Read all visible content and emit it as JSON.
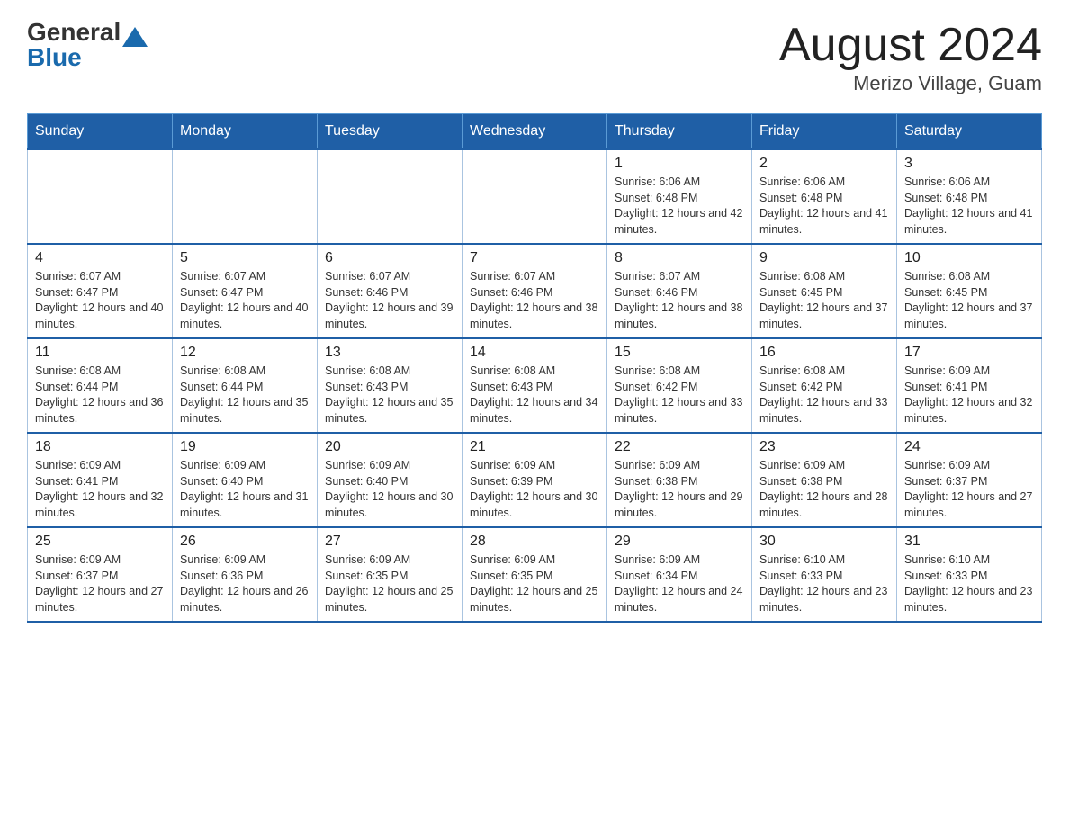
{
  "header": {
    "logo_general": "General",
    "logo_blue": "Blue",
    "title": "August 2024",
    "subtitle": "Merizo Village, Guam"
  },
  "days_of_week": [
    "Sunday",
    "Monday",
    "Tuesday",
    "Wednesday",
    "Thursday",
    "Friday",
    "Saturday"
  ],
  "weeks": [
    [
      {
        "day": "",
        "info": ""
      },
      {
        "day": "",
        "info": ""
      },
      {
        "day": "",
        "info": ""
      },
      {
        "day": "",
        "info": ""
      },
      {
        "day": "1",
        "info": "Sunrise: 6:06 AM\nSunset: 6:48 PM\nDaylight: 12 hours and 42 minutes."
      },
      {
        "day": "2",
        "info": "Sunrise: 6:06 AM\nSunset: 6:48 PM\nDaylight: 12 hours and 41 minutes."
      },
      {
        "day": "3",
        "info": "Sunrise: 6:06 AM\nSunset: 6:48 PM\nDaylight: 12 hours and 41 minutes."
      }
    ],
    [
      {
        "day": "4",
        "info": "Sunrise: 6:07 AM\nSunset: 6:47 PM\nDaylight: 12 hours and 40 minutes."
      },
      {
        "day": "5",
        "info": "Sunrise: 6:07 AM\nSunset: 6:47 PM\nDaylight: 12 hours and 40 minutes."
      },
      {
        "day": "6",
        "info": "Sunrise: 6:07 AM\nSunset: 6:46 PM\nDaylight: 12 hours and 39 minutes."
      },
      {
        "day": "7",
        "info": "Sunrise: 6:07 AM\nSunset: 6:46 PM\nDaylight: 12 hours and 38 minutes."
      },
      {
        "day": "8",
        "info": "Sunrise: 6:07 AM\nSunset: 6:46 PM\nDaylight: 12 hours and 38 minutes."
      },
      {
        "day": "9",
        "info": "Sunrise: 6:08 AM\nSunset: 6:45 PM\nDaylight: 12 hours and 37 minutes."
      },
      {
        "day": "10",
        "info": "Sunrise: 6:08 AM\nSunset: 6:45 PM\nDaylight: 12 hours and 37 minutes."
      }
    ],
    [
      {
        "day": "11",
        "info": "Sunrise: 6:08 AM\nSunset: 6:44 PM\nDaylight: 12 hours and 36 minutes."
      },
      {
        "day": "12",
        "info": "Sunrise: 6:08 AM\nSunset: 6:44 PM\nDaylight: 12 hours and 35 minutes."
      },
      {
        "day": "13",
        "info": "Sunrise: 6:08 AM\nSunset: 6:43 PM\nDaylight: 12 hours and 35 minutes."
      },
      {
        "day": "14",
        "info": "Sunrise: 6:08 AM\nSunset: 6:43 PM\nDaylight: 12 hours and 34 minutes."
      },
      {
        "day": "15",
        "info": "Sunrise: 6:08 AM\nSunset: 6:42 PM\nDaylight: 12 hours and 33 minutes."
      },
      {
        "day": "16",
        "info": "Sunrise: 6:08 AM\nSunset: 6:42 PM\nDaylight: 12 hours and 33 minutes."
      },
      {
        "day": "17",
        "info": "Sunrise: 6:09 AM\nSunset: 6:41 PM\nDaylight: 12 hours and 32 minutes."
      }
    ],
    [
      {
        "day": "18",
        "info": "Sunrise: 6:09 AM\nSunset: 6:41 PM\nDaylight: 12 hours and 32 minutes."
      },
      {
        "day": "19",
        "info": "Sunrise: 6:09 AM\nSunset: 6:40 PM\nDaylight: 12 hours and 31 minutes."
      },
      {
        "day": "20",
        "info": "Sunrise: 6:09 AM\nSunset: 6:40 PM\nDaylight: 12 hours and 30 minutes."
      },
      {
        "day": "21",
        "info": "Sunrise: 6:09 AM\nSunset: 6:39 PM\nDaylight: 12 hours and 30 minutes."
      },
      {
        "day": "22",
        "info": "Sunrise: 6:09 AM\nSunset: 6:38 PM\nDaylight: 12 hours and 29 minutes."
      },
      {
        "day": "23",
        "info": "Sunrise: 6:09 AM\nSunset: 6:38 PM\nDaylight: 12 hours and 28 minutes."
      },
      {
        "day": "24",
        "info": "Sunrise: 6:09 AM\nSunset: 6:37 PM\nDaylight: 12 hours and 27 minutes."
      }
    ],
    [
      {
        "day": "25",
        "info": "Sunrise: 6:09 AM\nSunset: 6:37 PM\nDaylight: 12 hours and 27 minutes."
      },
      {
        "day": "26",
        "info": "Sunrise: 6:09 AM\nSunset: 6:36 PM\nDaylight: 12 hours and 26 minutes."
      },
      {
        "day": "27",
        "info": "Sunrise: 6:09 AM\nSunset: 6:35 PM\nDaylight: 12 hours and 25 minutes."
      },
      {
        "day": "28",
        "info": "Sunrise: 6:09 AM\nSunset: 6:35 PM\nDaylight: 12 hours and 25 minutes."
      },
      {
        "day": "29",
        "info": "Sunrise: 6:09 AM\nSunset: 6:34 PM\nDaylight: 12 hours and 24 minutes."
      },
      {
        "day": "30",
        "info": "Sunrise: 6:10 AM\nSunset: 6:33 PM\nDaylight: 12 hours and 23 minutes."
      },
      {
        "day": "31",
        "info": "Sunrise: 6:10 AM\nSunset: 6:33 PM\nDaylight: 12 hours and 23 minutes."
      }
    ]
  ]
}
